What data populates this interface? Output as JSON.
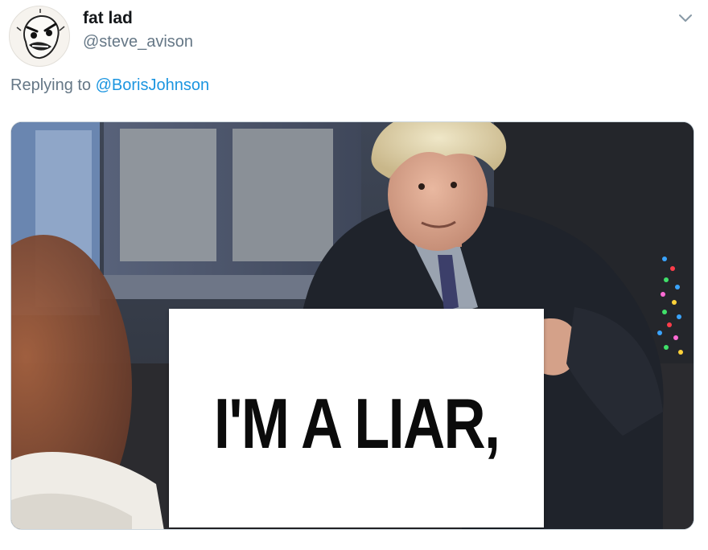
{
  "user": {
    "display_name": "fat lad",
    "handle": "@steve_avison"
  },
  "reply": {
    "prefix": "Replying to ",
    "mention": "@BorisJohnson"
  },
  "media": {
    "sign_text": "I'M A LIAR,"
  },
  "icons": {
    "menu": "chevron-down-icon"
  },
  "colors": {
    "link": "#1b95e0",
    "secondary_text": "#657786",
    "primary_text": "#14171a"
  }
}
